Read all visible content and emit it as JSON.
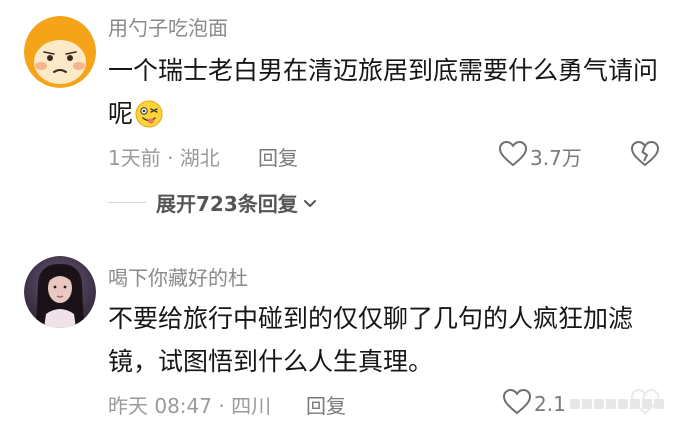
{
  "comments": [
    {
      "username": "用勺子吃泡面",
      "text": "一个瑞士老白男在清迈旅居到底需要什么勇气请问呢",
      "time_location": "1天前 · 湖北",
      "reply_label": "回复",
      "likes": "3.7万",
      "avatar_icon": "orange-crying-face-avatar",
      "emoji_icon": "silly-face-emoji",
      "expand_replies_label": "展开723条回复"
    },
    {
      "username": "喝下你藏好的杜",
      "text": "不要给旅行中碰到的仅仅聊了几句的人疯狂加滤镜，试图悟到什么人生真理。",
      "time_location": "昨天 08:47 · 四川",
      "reply_label": "回复",
      "likes": "2.1",
      "avatar_icon": "woman-portrait-avatar"
    }
  ],
  "colors": {
    "text_primary": "#161616",
    "text_secondary": "#8a8a8a",
    "avatar_orange": "#f5a41a"
  }
}
